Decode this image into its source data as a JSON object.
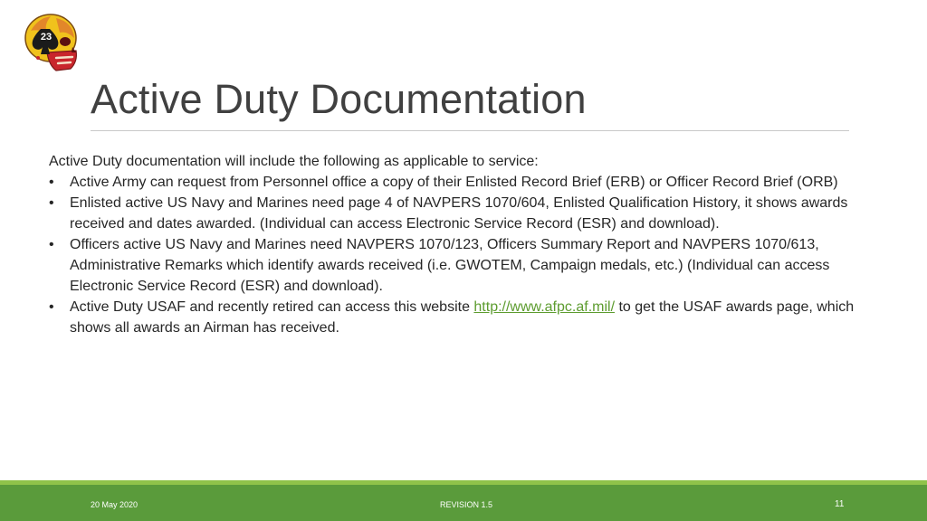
{
  "slide": {
    "logo_badge": "23",
    "title": "Active Duty Documentation",
    "intro": "Active Duty documentation will include the following as applicable to service:",
    "bullet_char": "•",
    "bullets": [
      "Active Army can request from Personnel office a copy of their Enlisted Record Brief (ERB) or Officer Record Brief (ORB)",
      "Enlisted active US Navy and Marines need page 4 of NAVPERS 1070/604, Enlisted Qualification History, it shows awards received and dates awarded.  (Individual can access Electronic Service Record (ESR) and download).",
      "Officers active US Navy and Marines need NAVPERS 1070/123, Officers Summary Report and NAVPERS 1070/613, Administrative Remarks which identify awards received (i.e. GWOTEM, Campaign medals, etc.) (Individual can access Electronic Service Record (ESR) and download)."
    ],
    "last_bullet": {
      "before": "Active Duty USAF and recently retired can access this website ",
      "link": "http://www.afpc.af.mil/",
      "after": " to get the USAF awards page, which shows all awards an Airman has received."
    }
  },
  "footer": {
    "date": "20 May 2020",
    "revision": "REVISION 1.5",
    "page_number": "11"
  },
  "colors": {
    "footer_bar": "#5a9b3b",
    "footer_stripe": "#8fc34a",
    "link": "#5d9c2f",
    "title": "#404040",
    "logo_skull": "#f0c21c",
    "logo_red": "#c9262c"
  }
}
